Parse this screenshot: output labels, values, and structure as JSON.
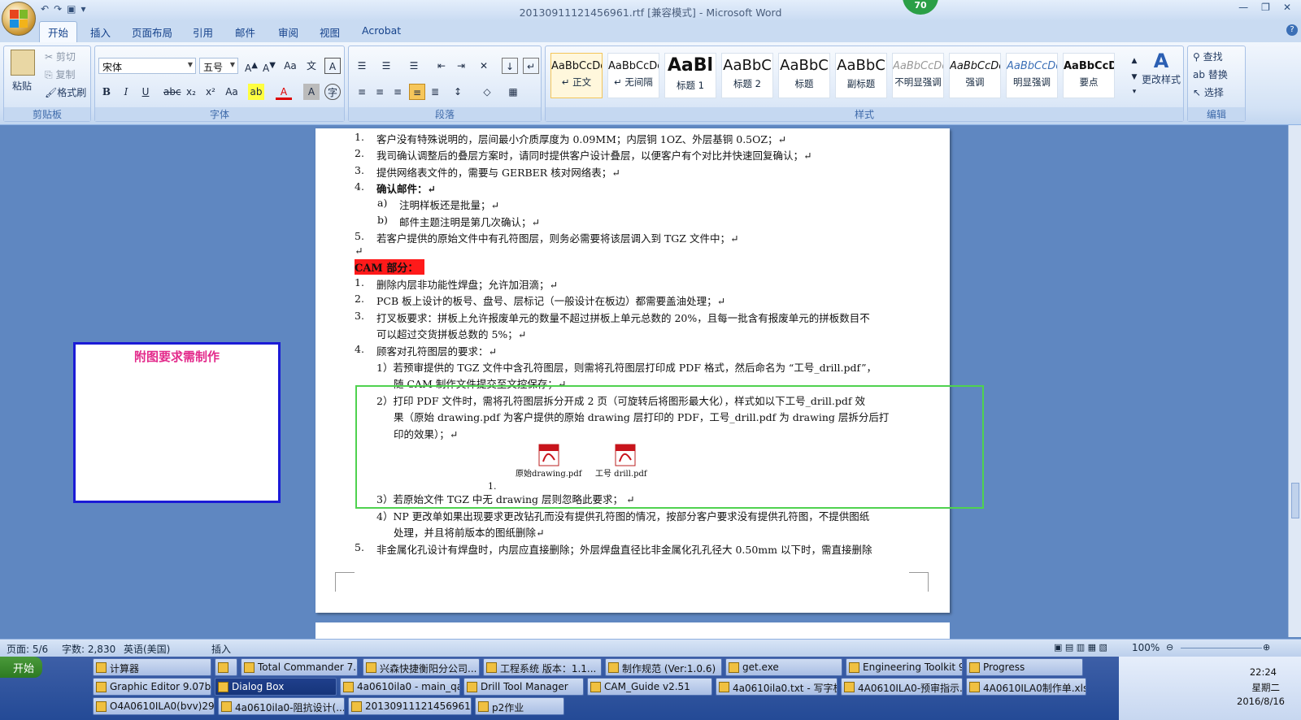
{
  "window": {
    "title": "20130911121456961.rtf [兼容模式] - Microsoft Word",
    "badge": "70"
  },
  "tabs": [
    "开始",
    "插入",
    "页面布局",
    "引用",
    "邮件",
    "审阅",
    "视图",
    "Acrobat"
  ],
  "ribbon": {
    "clipboard": {
      "paste": "粘贴",
      "cut": "剪切",
      "copy": "复制",
      "format_painter": "格式刷",
      "label": "剪贴板"
    },
    "font": {
      "name": "宋体",
      "size": "五号",
      "label": "字体"
    },
    "paragraph": {
      "label": "段落"
    },
    "styles": {
      "label": "样式",
      "items": [
        {
          "sample": "AaBbCcDd",
          "name": "↵ 正文"
        },
        {
          "sample": "AaBbCcDd",
          "name": "↵ 无间隔"
        },
        {
          "sample": "AaBl",
          "name": "标题 1"
        },
        {
          "sample": "AaBbC",
          "name": "标题 2"
        },
        {
          "sample": "AaBbC",
          "name": "标题"
        },
        {
          "sample": "AaBbC",
          "name": "副标题"
        },
        {
          "sample": "AaBbCcDd",
          "name": "不明显强调"
        },
        {
          "sample": "AaBbCcDd",
          "name": "强调"
        },
        {
          "sample": "AaBbCcDd",
          "name": "明显强调"
        },
        {
          "sample": "AaBbCcD",
          "name": "要点"
        }
      ],
      "change_styles": "更改样式"
    },
    "editing": {
      "find": "查找",
      "replace": "替换",
      "select": "选择",
      "label": "编辑"
    }
  },
  "document": {
    "top_list": [
      {
        "n": "1.",
        "text": "客户没有特殊说明的，层间最小介质厚度为 0.09MM；内层铜 1OZ、外层基铜 0.5OZ；↵"
      },
      {
        "n": "2.",
        "text": "我司确认调整后的叠层方案时，请同时提供客户设计叠层，以便客户有个对比并快速回复确认；↵"
      },
      {
        "n": "3.",
        "text": "提供网络表文件的，需要与 GERBER 核对网络表；↵"
      },
      {
        "n": "4.",
        "text": "确认邮件：↵"
      },
      {
        "n": "a)",
        "text": "注明样板还是批量；↵"
      },
      {
        "n": "b)",
        "text": "邮件主题注明是第几次确认；↵"
      },
      {
        "n": "5.",
        "text": "若客户提供的原始文件中有孔符图层，则务必需要将该层调入到 TGZ 文件中；↵"
      }
    ],
    "cam_heading": "CAM 部分：",
    "cam_list": [
      {
        "n": "1.",
        "text": "删除内层非功能性焊盘；允许加泪滴；↵"
      },
      {
        "n": "2.",
        "text": "PCB 板上设计的板号、盘号、层标记（一般设计在板边）都需要盖油处理；↵"
      },
      {
        "n": "3.",
        "text": "打叉板要求：拼板上允许报废单元的数量不超过拼板上单元总数的 20%，且每一批含有报废单元的拼板数目不"
      },
      {
        "n": "",
        "text": "可以超过交货拼板总数的 5%；↵"
      },
      {
        "n": "4.",
        "text": "顾客对孔符图层的要求：↵"
      },
      {
        "n": "",
        "text": "1）若预审提供的 TGZ 文件中含孔符图层，则需将孔符图层打印成 PDF 格式，然后命名为 “工号_drill.pdf”，"
      },
      {
        "n": "",
        "text": "随 CAM 制作文件提交至文控保存；↵"
      },
      {
        "n": "",
        "text": "2）打印 PDF 文件时，需将孔符图层拆分开成 2 页（可旋转后将图形最大化），样式如以下工号_drill.pdf 效"
      },
      {
        "n": "",
        "text": "果（原始 drawing.pdf 为客户提供的原始 drawing 层打印的 PDF，工号_drill.pdf 为 drawing 层拆分后打"
      },
      {
        "n": "",
        "text": "印的效果）；↵"
      },
      {
        "n": "",
        "text": "3）若原始文件 TGZ 中无 drawing 层则忽略此要求；  ↵"
      },
      {
        "n": "",
        "text": "4）NP 更改单如果出现要求更改钻孔而没有提供孔符图的情况，按部分客户要求没有提供孔符图，不提供图纸"
      },
      {
        "n": "",
        "text": "处理，并且将前版本的图纸删除↵"
      },
      {
        "n": "5.",
        "text": "非金属化孔设计有焊盘时，内层应直接删除；外层焊盘直径比非金属化孔孔径大 0.50mm 以下时，需直接删除"
      }
    ],
    "attachments": [
      {
        "label": "原始drawing.pdf"
      },
      {
        "label": "工号 drill.pdf"
      }
    ],
    "stray_number": "1.",
    "empty_para": "↵"
  },
  "note_box": {
    "text": "附图要求需制作"
  },
  "statusbar": {
    "page": "页面: 5/6",
    "words": "字数: 2,830",
    "language": "英语(美国)",
    "mode": "插入",
    "zoom": "100%"
  },
  "taskbar": {
    "start": "开始",
    "row1": [
      "计算器",
      "",
      "Total Commander 7.0 ...",
      "兴森快捷衡阳分公司...",
      "工程系统  版本：1.1...",
      "制作规范 (Ver:1.0.6)",
      "get.exe",
      "Engineering Toolkit 9.0...",
      "Progress"
    ],
    "row2": [
      "Graphic Editor 9.07b2 (...",
      "Dialog Box",
      "4a0610ila0 - main_qa",
      "Drill Tool Manager",
      "CAM_Guide v2.51",
      "4a0610ila0.txt - 写字板",
      "4A0610ILA0-预审指示...",
      "4A0610ILA0制作单.xls ..."
    ],
    "row3": [
      "O4A0610ILA0(bvv)29...",
      "4a0610ila0-阻抗设计(...",
      "20130911121456961...",
      "p2作业"
    ],
    "time": "22:24",
    "weekday": "星期二",
    "date": "2016/8/16"
  },
  "colors": {
    "accent": "#15428b",
    "cam_highlight": "#ff1a1a",
    "note_border": "#1b1bd6",
    "note_text": "#e32a8b",
    "green_frame": "#4fd24f"
  }
}
